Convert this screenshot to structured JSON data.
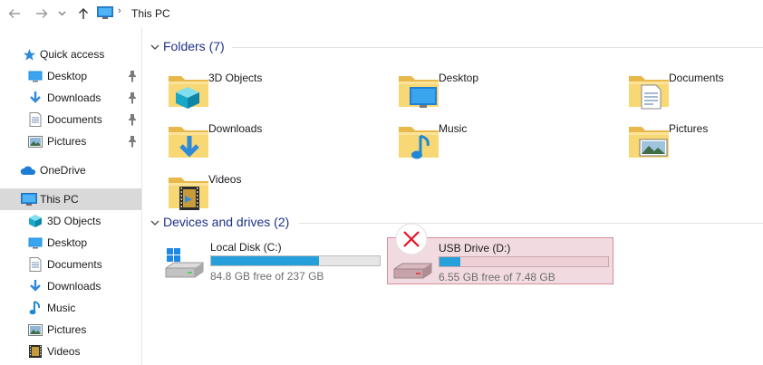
{
  "address": {
    "back_icon": "back-arrow-icon",
    "forward_icon": "forward-arrow-icon",
    "history_icon": "chevron-down-icon",
    "up_icon": "up-arrow-icon",
    "location": "This PC"
  },
  "sidebar": {
    "quick_access": {
      "label": "Quick access",
      "items": [
        {
          "label": "Desktop",
          "icon": "desktop-icon",
          "pinned": true
        },
        {
          "label": "Downloads",
          "icon": "downloads-icon",
          "pinned": true
        },
        {
          "label": "Documents",
          "icon": "documents-icon",
          "pinned": true
        },
        {
          "label": "Pictures",
          "icon": "pictures-icon",
          "pinned": true
        }
      ]
    },
    "onedrive": {
      "label": "OneDrive"
    },
    "this_pc": {
      "label": "This PC",
      "items": [
        {
          "label": "3D Objects"
        },
        {
          "label": "Desktop"
        },
        {
          "label": "Documents"
        },
        {
          "label": "Downloads"
        },
        {
          "label": "Music"
        },
        {
          "label": "Pictures"
        },
        {
          "label": "Videos"
        }
      ]
    }
  },
  "folders": {
    "title": "Folders (7)",
    "items": [
      {
        "label": "3D Objects"
      },
      {
        "label": "Desktop"
      },
      {
        "label": "Documents"
      },
      {
        "label": "Downloads"
      },
      {
        "label": "Music"
      },
      {
        "label": "Pictures"
      },
      {
        "label": "Videos"
      }
    ]
  },
  "drives": {
    "title": "Devices and drives (2)",
    "items": [
      {
        "label": "Local Disk (C:)",
        "free_text": "84.8 GB free of 237 GB",
        "used_fraction": 0.642,
        "selected": false
      },
      {
        "label": "USB Drive (D:)",
        "free_text": "6.55 GB free of 7.48 GB",
        "used_fraction": 0.124,
        "selected": true
      }
    ]
  },
  "colors": {
    "accent": "#26a0da",
    "group_title": "#1e3287",
    "selection": "#d9d9d9",
    "drive_selected_bg": "#f2dbe0",
    "error": "#e81123"
  }
}
